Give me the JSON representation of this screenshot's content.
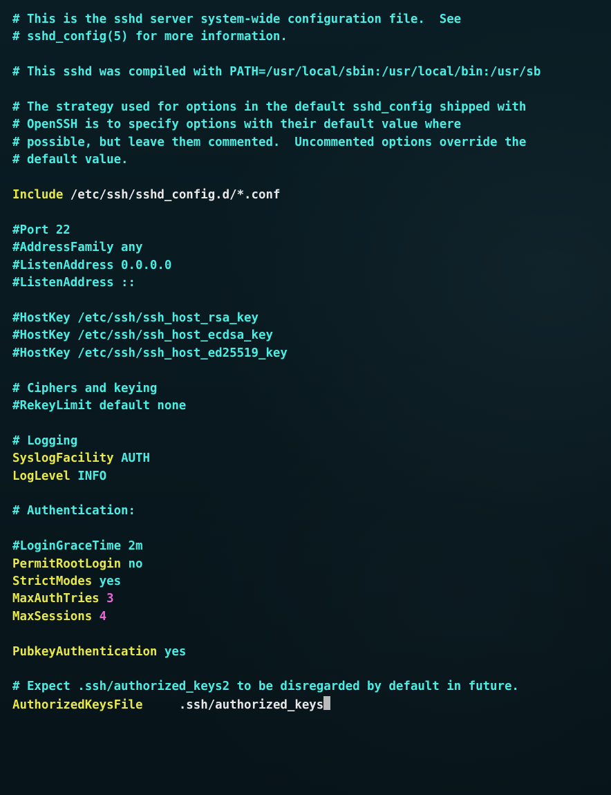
{
  "lines": {
    "c1": "# This is the sshd server system-wide configuration file.  See",
    "c2": "# sshd_config(5) for more information.",
    "c3": "# This sshd was compiled with PATH=/usr/local/sbin:/usr/local/bin:/usr/sb",
    "c4": "# The strategy used for options in the default sshd_config shipped with",
    "c5": "# OpenSSH is to specify options with their default value where",
    "c6": "# possible, but leave them commented.  Uncommented options override the",
    "c7": "# default value.",
    "kw_include": "Include",
    "include_path": "/etc/ssh/sshd_config.d/*.conf",
    "c8": "#Port 22",
    "c9": "#AddressFamily any",
    "c10": "#ListenAddress 0.0.0.0",
    "c11": "#ListenAddress ::",
    "c12": "#HostKey /etc/ssh/ssh_host_rsa_key",
    "c13": "#HostKey /etc/ssh/ssh_host_ecdsa_key",
    "c14": "#HostKey /etc/ssh/ssh_host_ed25519_key",
    "c15": "# Ciphers and keying",
    "c16": "#RekeyLimit default none",
    "c17": "# Logging",
    "kw_syslog": "SyslogFacility",
    "val_syslog": "AUTH",
    "kw_loglevel": "LogLevel",
    "val_loglevel": "INFO",
    "c18": "# Authentication:",
    "c19": "#LoginGraceTime 2m",
    "kw_permitroot": "PermitRootLogin",
    "val_permitroot": "no",
    "kw_strict": "StrictModes",
    "val_strict": "yes",
    "kw_maxauth": "MaxAuthTries",
    "val_maxauth": "3",
    "kw_maxsess": "MaxSessions",
    "val_maxsess": "4",
    "kw_pubkey": "PubkeyAuthentication",
    "val_pubkey": "yes",
    "c20": "# Expect .ssh/authorized_keys2 to be disregarded by default in future.",
    "kw_authkeys": "AuthorizedKeysFile",
    "val_authkeys": ".ssh/authorized_keys"
  }
}
